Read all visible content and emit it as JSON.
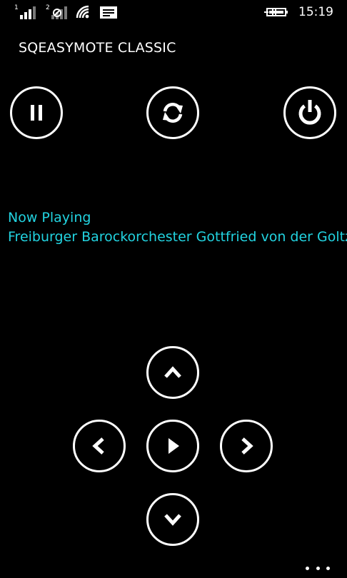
{
  "status_bar": {
    "sim1": "1",
    "sim2": "2",
    "time": "15:19"
  },
  "app": {
    "title": "SQEASYMOTE CLASSIC"
  },
  "top_controls": {
    "pause": "pause-icon",
    "refresh": "refresh-icon",
    "power": "power-icon"
  },
  "now_playing": {
    "heading": "Now Playing",
    "artist": "Freiburger Barockorchester Gottfried von der Goltz"
  },
  "dpad": {
    "up": "chevron-up-icon",
    "left": "chevron-left-icon",
    "play": "play-icon",
    "right": "chevron-right-icon",
    "down": "chevron-down-icon"
  },
  "colors": {
    "background": "#000000",
    "accent": "#22d3e0",
    "foreground": "#ffffff"
  }
}
